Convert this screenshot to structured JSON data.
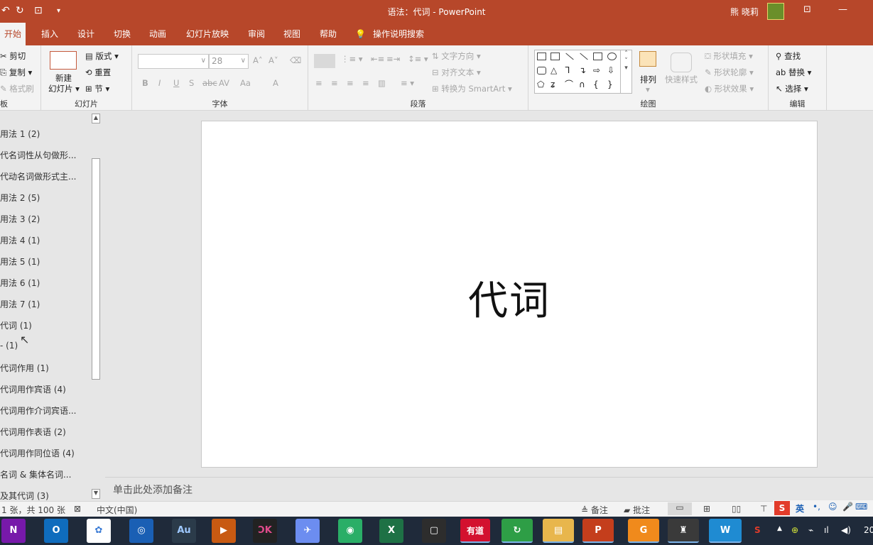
{
  "window": {
    "title": "语法：代词  -  PowerPoint",
    "user": "熊 晓莉",
    "controls": [
      "ribbon-display-icon",
      "minimize-icon",
      "maximize-icon",
      "close-icon"
    ]
  },
  "tabs": [
    "开始",
    "插入",
    "设计",
    "切换",
    "动画",
    "幻灯片放映",
    "审阅",
    "视图",
    "帮助"
  ],
  "tell_me": "操作说明搜索",
  "ribbon": {
    "clipboard": {
      "cut": "剪切",
      "copy": "复制",
      "format_painter": "格式刷",
      "label": "板"
    },
    "slides": {
      "new_slide": "新建",
      "new_slide2": "幻灯片",
      "layout": "版式",
      "reset": "重置",
      "section": "节",
      "label": "幻灯片"
    },
    "font": {
      "font_size": "28",
      "label": "字体",
      "bold": "B",
      "italic": "I",
      "underline": "U",
      "shadow": "S",
      "strike": "abc",
      "spacing": "AV",
      "case": "Aa",
      "color": "A"
    },
    "paragraph": {
      "text_direction": "文字方向",
      "align_text": "对齐文本",
      "smartart": "转换为 SmartArt",
      "label": "段落"
    },
    "drawing": {
      "arrange": "排列",
      "quick_styles": "快速样式",
      "shape_fill": "形状填充",
      "shape_outline": "形状轮廓",
      "shape_effects": "形状效果",
      "label": "绘图"
    },
    "editing": {
      "find": "查找",
      "replace": "替换",
      "select": "选择",
      "label": "编辑"
    }
  },
  "slides_list": [
    "用法 1 (2)",
    "代名词性从句做形...",
    "代动名词做形式主...",
    "用法 2 (5)",
    "用法 3 (2)",
    "用法 4 (1)",
    "用法 5 (1)",
    "用法 6 (1)",
    "用法 7 (1)",
    "代词 (1)",
    "- (1)",
    "代词作用 (1)",
    "代词用作宾语 (4)",
    "代词用作介词宾语...",
    "代词用作表语 (2)",
    "代词用作同位语 (4)",
    "名词 & 集体名词...",
    "及其代词 (3)"
  ],
  "slide": {
    "title": "代词"
  },
  "notes_placeholder": "单击此处添加备注",
  "status": {
    "slide_count": "1 张，共 100 张",
    "language": "中文(中国)",
    "notes": "备注",
    "comments": "批注"
  },
  "taskbar": {
    "apps": [
      {
        "name": "onenote",
        "label": "N",
        "color": "#7719aa"
      },
      {
        "name": "outlook",
        "label": "O",
        "color": "#0f6cbd"
      },
      {
        "name": "photos",
        "label": "✿",
        "color": "#ffffff"
      },
      {
        "name": "search",
        "label": "◎",
        "color": "#1a5fb4"
      },
      {
        "name": "audition",
        "label": "Au",
        "color": "#2b3b4a"
      },
      {
        "name": "media",
        "label": "▶",
        "color": "#c85a12"
      },
      {
        "name": "obs",
        "label": "ƆK",
        "color": "#222222"
      },
      {
        "name": "mail",
        "label": "✈",
        "color": "#6c8df0"
      },
      {
        "name": "wechat",
        "label": "◉",
        "color": "#2aae67"
      },
      {
        "name": "excel",
        "label": "X",
        "color": "#1e7145"
      },
      {
        "name": "video",
        "label": "▢",
        "color": "#2d2d2d"
      },
      {
        "name": "youdao",
        "label": "有道",
        "color": "#d3112f"
      },
      {
        "name": "browser",
        "label": "↻",
        "color": "#2e9e46"
      },
      {
        "name": "explorer",
        "label": "▤",
        "color": "#e8b64c"
      },
      {
        "name": "powerpoint",
        "label": "P",
        "color": "#c43e1c"
      },
      {
        "name": "pdf",
        "label": "G",
        "color": "#f08a1c"
      },
      {
        "name": "reader",
        "label": "♜",
        "color": "#3a3a3a"
      },
      {
        "name": "wps",
        "label": "W",
        "color": "#1f8bd2"
      }
    ],
    "tray_lang": "英",
    "clock": "20"
  }
}
